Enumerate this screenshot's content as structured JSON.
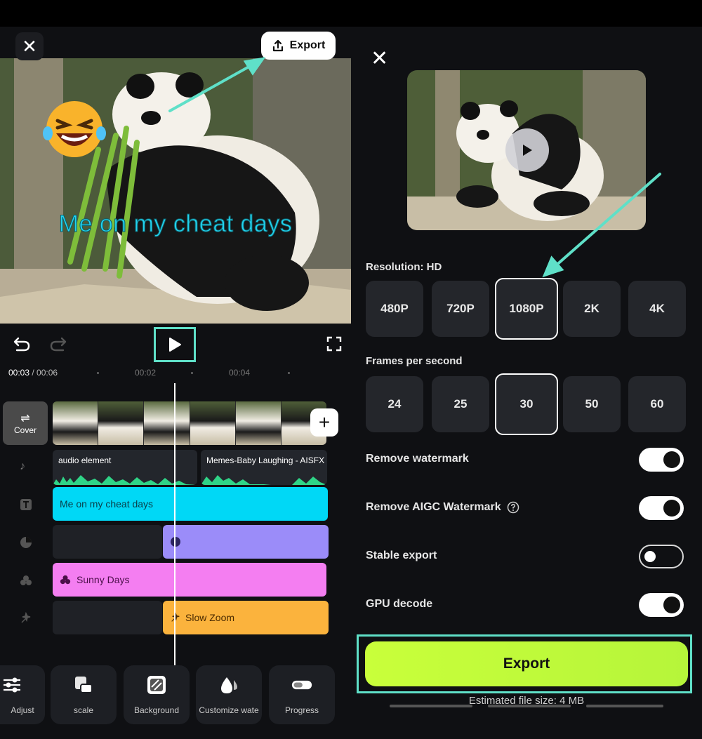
{
  "editor": {
    "export_label": "Export",
    "caption": "Me on my cheat days",
    "time_current": "00:03",
    "time_total": "/ 00:06",
    "tick_1": "00:02",
    "tick_2": "00:04",
    "cover_label": "Cover",
    "audio_1": "audio element",
    "audio_2": "Memes-Baby Laughing - AISFX",
    "text_track": "Me on my cheat days",
    "filter_track": "Sunny Days",
    "effect_track": "Slow Zoom",
    "tools": [
      "Adjust",
      "scale",
      "Background",
      "Customize wate",
      "Progress"
    ]
  },
  "export_panel": {
    "resolution_label": "Resolution: HD",
    "resolutions": [
      "480P",
      "720P",
      "1080P",
      "2K",
      "4K"
    ],
    "selected_resolution": "1080P",
    "fps_label": "Frames per second",
    "fps_options": [
      "24",
      "25",
      "30",
      "50",
      "60"
    ],
    "selected_fps": "30",
    "settings": [
      {
        "label": "Remove watermark",
        "on": true
      },
      {
        "label": "Remove AIGC Watermark",
        "on": true
      },
      {
        "label": "Stable export",
        "on": false
      },
      {
        "label": "GPU decode",
        "on": true
      }
    ],
    "export_label": "Export",
    "estimate": "Estimated file size: 4 MB"
  },
  "colors": {
    "accent": "#5fe0c8",
    "export_green": "#c9ff3a",
    "text_track": "#00d8f6",
    "sticker_track": "#9b8cf9",
    "filter_track": "#f47ef1",
    "effect_track": "#fbb33d"
  }
}
